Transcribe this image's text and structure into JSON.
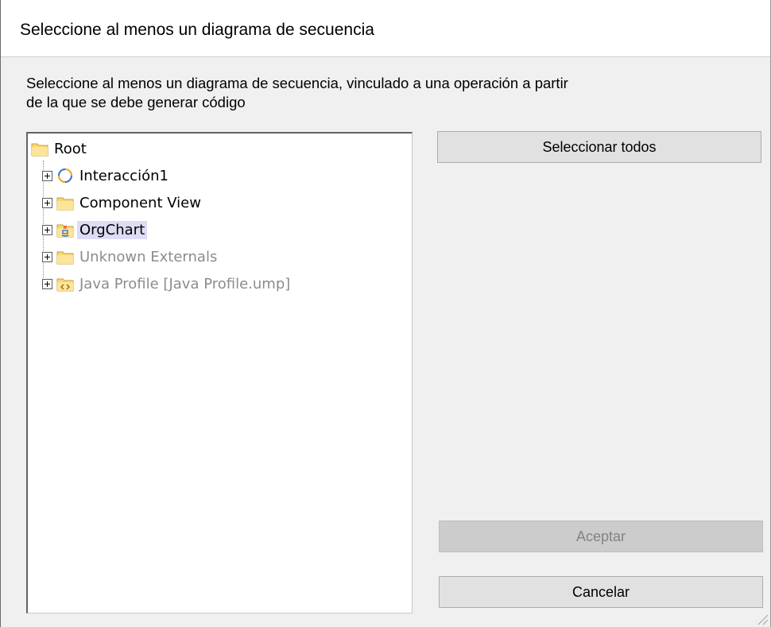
{
  "dialog": {
    "title": "Seleccione al menos un diagrama de secuencia",
    "description_line1": "Seleccione al menos un diagrama de secuencia, vinculado a una operación a partir",
    "description_line2": "de la que se debe generar código"
  },
  "tree": {
    "root": {
      "label": "Root",
      "icon": "folder-icon"
    },
    "items": [
      {
        "label": "Interacción1",
        "icon": "interaction-icon",
        "dimmed": false,
        "selected": false
      },
      {
        "label": "Component View",
        "icon": "folder-icon",
        "dimmed": false,
        "selected": false
      },
      {
        "label": "OrgChart",
        "icon": "java-package-icon",
        "dimmed": false,
        "selected": true
      },
      {
        "label": "Unknown Externals",
        "icon": "folder-icon",
        "dimmed": true,
        "selected": false
      },
      {
        "label": "Java Profile [Java Profile.ump]",
        "icon": "profile-folder-icon",
        "dimmed": true,
        "selected": false
      }
    ]
  },
  "buttons": {
    "select_all": "Seleccionar todos",
    "accept": "Aceptar",
    "cancel": "Cancelar"
  },
  "colors": {
    "folder": "#f8d775",
    "selection": "#dcdcf5",
    "dim_text": "#8c8c8c",
    "button_face": "#e1e1e1"
  }
}
